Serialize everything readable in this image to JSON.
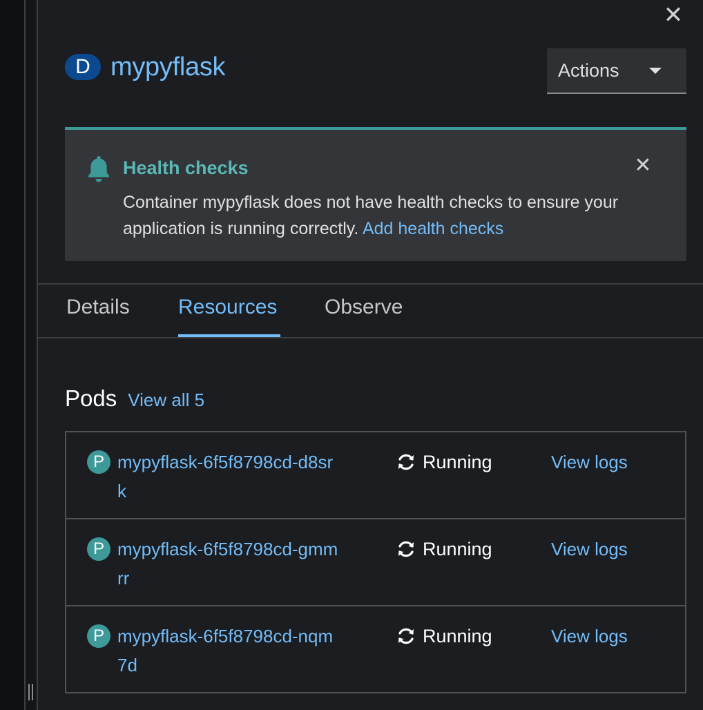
{
  "panel": {
    "close_icon": "close-icon",
    "resource_badge": "D",
    "resource_name": "mypyflask",
    "actions_label": "Actions"
  },
  "alert": {
    "icon": "bell-icon",
    "title": "Health checks",
    "message": "Container mypyflask does not have health checks to ensure your application is running correctly.",
    "link_label": "Add health checks",
    "accent_color": "#3d9a98"
  },
  "tabs": [
    {
      "label": "Details",
      "active": false
    },
    {
      "label": "Resources",
      "active": true
    },
    {
      "label": "Observe",
      "active": false
    }
  ],
  "pods": {
    "title": "Pods",
    "view_all_label": "View all 5",
    "rows": [
      {
        "badge": "P",
        "name": "mypyflask-6f5f8798cd-d8srk",
        "status": "Running",
        "status_icon": "sync-icon",
        "logs_label": "View logs"
      },
      {
        "badge": "P",
        "name": "mypyflask-6f5f8798cd-gmmrr",
        "status": "Running",
        "status_icon": "sync-icon",
        "logs_label": "View logs"
      },
      {
        "badge": "P",
        "name": "mypyflask-6f5f8798cd-nqm7d",
        "status": "Running",
        "status_icon": "sync-icon",
        "logs_label": "View logs"
      }
    ]
  },
  "colors": {
    "link": "#73bcf7",
    "background": "#1b1d21",
    "resource_badge": "#0b4a8f",
    "pod_badge": "#3d9a98"
  }
}
